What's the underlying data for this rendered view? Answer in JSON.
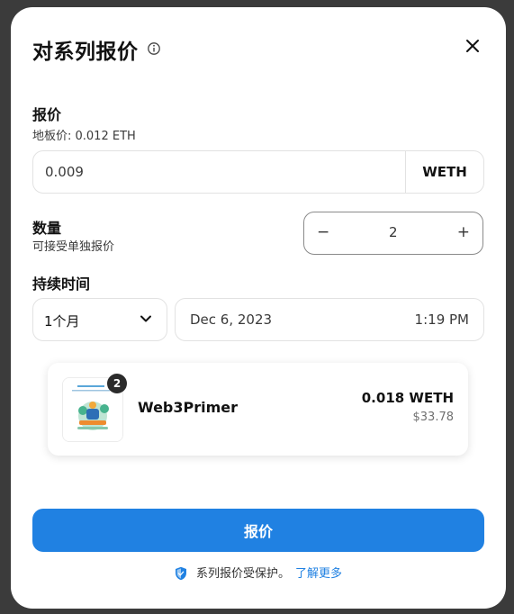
{
  "modal": {
    "title": "对系列报价",
    "close_icon": "close-icon",
    "info_icon": "info-icon"
  },
  "price": {
    "label": "报价",
    "floor": "地板价: 0.012 ETH",
    "value": "0.009",
    "currency": "WETH"
  },
  "quantity": {
    "label": "数量",
    "sub": "可接受单独报价",
    "minus": "−",
    "value": "2",
    "plus": "+"
  },
  "duration": {
    "label": "持续时间",
    "selected": "1个月",
    "date": "Dec 6, 2023",
    "time": "1:19 PM"
  },
  "item": {
    "badge": "2",
    "name": "Web3Primer",
    "price": "0.018 WETH",
    "usd": "$33.78"
  },
  "submit_label": "报价",
  "footer": {
    "text": "系列报价受保护。",
    "link": "了解更多"
  },
  "colors": {
    "accent": "#2081e2",
    "overlay": "#3b3b3b"
  }
}
